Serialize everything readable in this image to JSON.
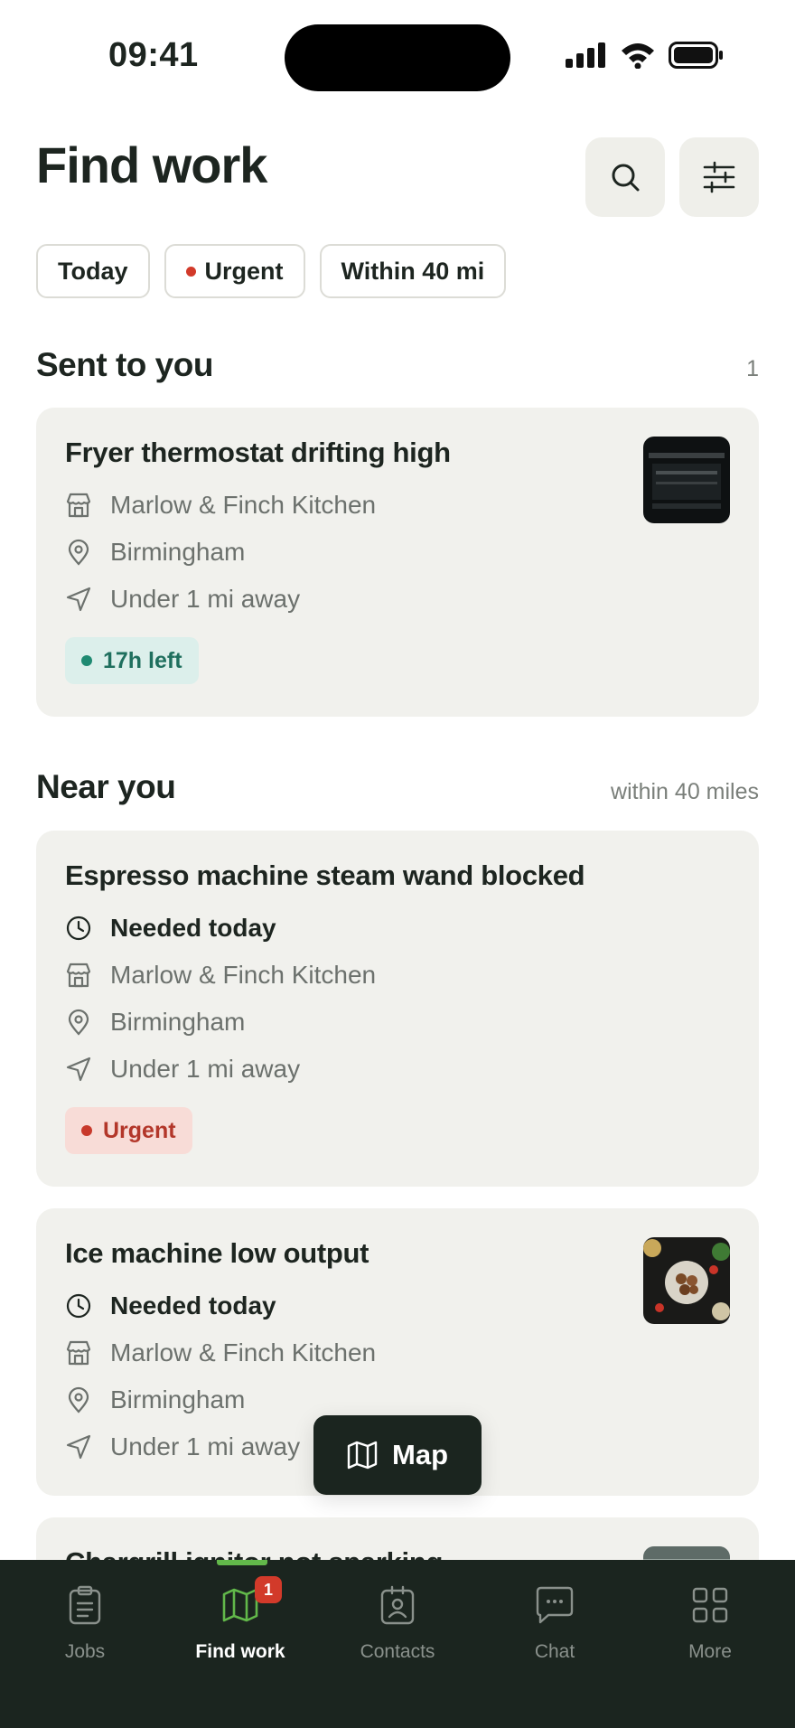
{
  "status_bar": {
    "time": "09:41"
  },
  "header": {
    "title": "Find work"
  },
  "filters": [
    {
      "label": "Today",
      "dot_color": null
    },
    {
      "label": "Urgent",
      "dot_color": "#d23a2a"
    },
    {
      "label": "Within 40 mi",
      "dot_color": null
    }
  ],
  "sent_section": {
    "title": "Sent to you",
    "count": "1"
  },
  "sent_jobs": [
    {
      "title": "Fryer thermostat drifting high",
      "business": "Marlow & Finch Kitchen",
      "city": "Birmingham",
      "distance": "Under 1 mi away",
      "badge": "17h left",
      "badge_color": "#1f8a72",
      "badge_bg": "#dcefeb"
    }
  ],
  "near_section": {
    "title": "Near you",
    "meta": "within 40 miles"
  },
  "near_jobs": [
    {
      "title": "Espresso machine steam wand blocked",
      "when": "Needed today",
      "business": "Marlow & Finch Kitchen",
      "city": "Birmingham",
      "distance": "Under 1 mi away",
      "badge": "Urgent",
      "badge_color": "#c8392b",
      "badge_bg": "#f8dcd7"
    },
    {
      "title": "Ice machine low output",
      "when": "Needed today",
      "business": "Marlow & Finch Kitchen",
      "city": "Birmingham",
      "distance": "Under 1 mi away"
    },
    {
      "title": "Chargrill ignitor not sparking"
    }
  ],
  "map_button": {
    "label": "Map"
  },
  "tabbar": {
    "tabs": [
      {
        "label": "Jobs",
        "icon": "clipboard-icon"
      },
      {
        "label": "Find work",
        "icon": "map-icon",
        "badge": "1",
        "active": true
      },
      {
        "label": "Contacts",
        "icon": "contact-card-icon"
      },
      {
        "label": "Chat",
        "icon": "chat-bubble-icon"
      },
      {
        "label": "More",
        "icon": "grid-icon"
      }
    ]
  },
  "colors": {
    "dark": "#1b251f",
    "card_bg": "#f1f1ed",
    "accent_green": "#62b84a",
    "urgent_red": "#d23a2a"
  }
}
